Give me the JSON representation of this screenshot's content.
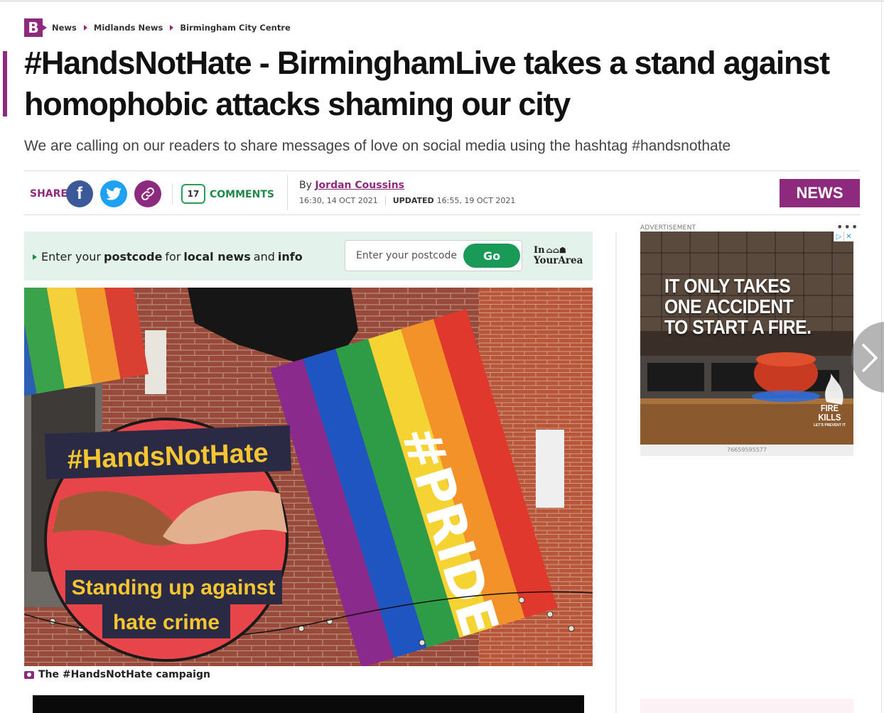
{
  "site": {
    "logo_letter": "B"
  },
  "breadcrumb": [
    "News",
    "Midlands News",
    "Birmingham City Centre"
  ],
  "headline": "#HandsNotHate - BirminghamLive takes a stand against homophobic attacks shaming our city",
  "standfirst": "We are calling on our readers to share messages of love on social media using the hashtag #handsnothate",
  "share": {
    "label": "SHARE",
    "facebook_glyph": "f"
  },
  "comments": {
    "count": "17",
    "label": "COMMENTS"
  },
  "byline": {
    "prefix": "By",
    "author": "Jordan Coussins",
    "published": "16:30, 14 OCT 2021",
    "updated_label": "UPDATED",
    "updated": "16:55, 19 OCT 2021"
  },
  "section_tag": "NEWS",
  "postcode": {
    "prompt_parts": [
      "Enter your",
      "postcode",
      "for",
      "local news",
      "and",
      "info"
    ],
    "placeholder": "Enter your postcode",
    "button": "Go",
    "brand_line1": "In",
    "brand_line2": "YourArea"
  },
  "hero": {
    "badge_title": "#HandsNotHate",
    "badge_line1": "Standing up against",
    "badge_line2": "hate crime",
    "flag_text": "#PRIDE",
    "caption": "The #HandsNotHate campaign"
  },
  "advert": {
    "label": "ADVERTISEMENT",
    "menu": "•••",
    "controls": [
      "▷",
      "✕"
    ],
    "headline_lines": [
      "IT ONLY TAKES",
      "ONE ACCIDENT",
      "TO START A FIRE."
    ],
    "brand_lines": [
      "FIRE",
      "KILLS"
    ],
    "brand_sub": "LET'S PREVENT IT",
    "id": "76659595577"
  },
  "colors": {
    "brand": "#8e2a7e",
    "green": "#1a9a57",
    "facebook": "#3b5998",
    "twitter": "#1da1f2"
  }
}
